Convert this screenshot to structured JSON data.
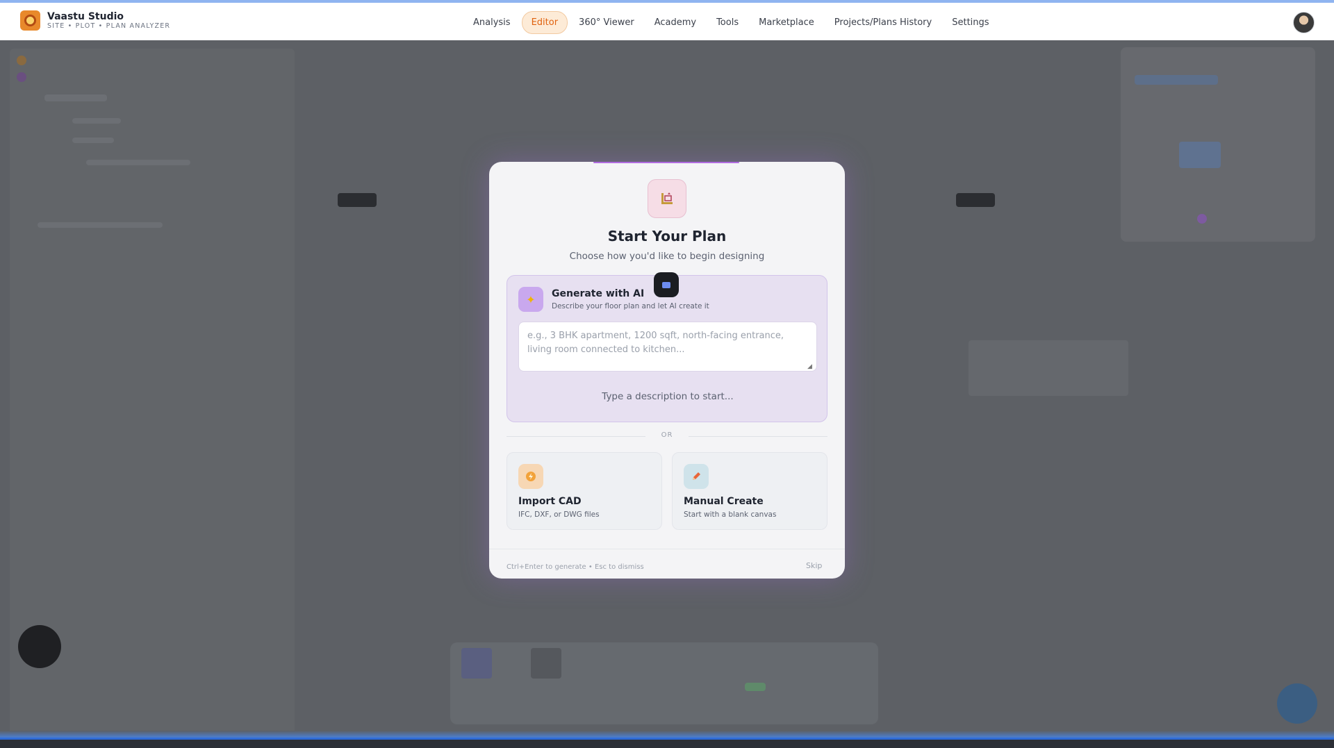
{
  "app": {
    "name": "Vaastu Studio",
    "subtitle": "SITE • PLOT • PLAN ANALYZER"
  },
  "nav": {
    "items": [
      {
        "label": "Analysis",
        "active": false
      },
      {
        "label": "Editor",
        "active": true
      },
      {
        "label": "360° Viewer",
        "active": false
      },
      {
        "label": "Academy",
        "active": false
      },
      {
        "label": "Tools",
        "active": false
      },
      {
        "label": "Marketplace",
        "active": false
      },
      {
        "label": "Projects/Plans History",
        "active": false
      },
      {
        "label": "Settings",
        "active": false
      }
    ]
  },
  "modal": {
    "title": "Start Your Plan",
    "subtitle": "Choose how you'd like to begin designing",
    "ai": {
      "title": "Generate with AI",
      "description": "Describe your floor plan and let AI create it",
      "placeholder": "e.g., 3 BHK apartment, 1200 sqft, north-facing entrance, living room connected to kitchen...",
      "value": "",
      "start_hint": "Type a description to start..."
    },
    "divider": "OR",
    "import_cad": {
      "title": "Import CAD",
      "description": "IFC, DXF, or DWG files"
    },
    "manual_create": {
      "title": "Manual Create",
      "description": "Start with a blank canvas"
    },
    "footer_hint": "Ctrl+Enter to generate • Esc to dismiss",
    "skip_label": "Skip"
  },
  "icons": {
    "plan": "floor-plan-icon",
    "ai": "sparkle-icon",
    "import": "lightning-icon",
    "manual": "pencil-icon",
    "chip": "screen-icon"
  },
  "colors": {
    "accent": "#e0620f",
    "ai_card": "#e7e0f1",
    "ai_icon": "#c9a8ee",
    "import_icon": "#f7d7b4",
    "manual_icon": "#cfe3ea"
  }
}
